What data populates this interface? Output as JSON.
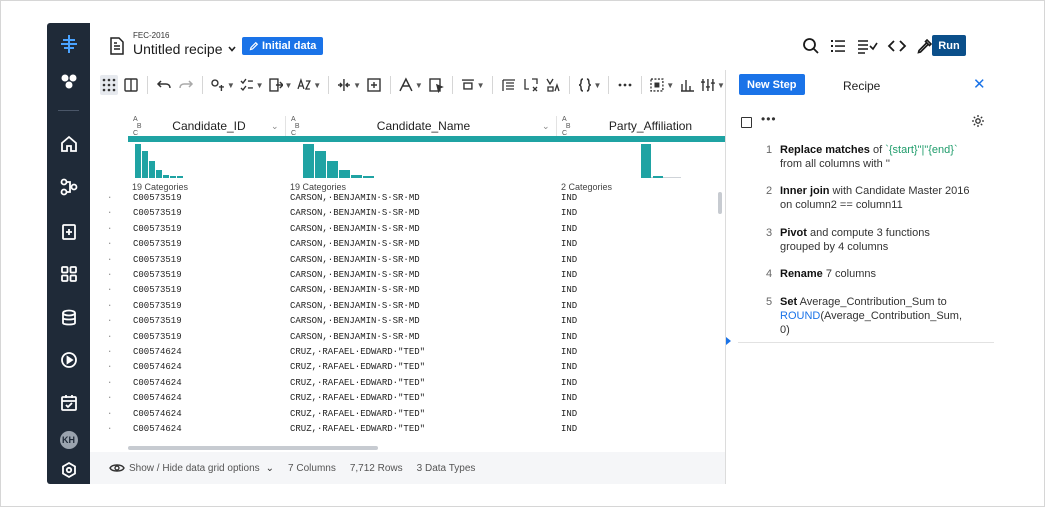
{
  "header": {
    "flow_name": "FEC-2016",
    "recipe_title": "Untitled recipe",
    "badge_label": "Initial data",
    "run_label": "Run",
    "icons": [
      "search-icon",
      "list-icon",
      "list-check-icon",
      "code-icon",
      "pipette-icon"
    ]
  },
  "rail": {
    "icons": [
      "logo-icon",
      "molecule-icon",
      "home-icon",
      "flow-icon",
      "recipe-icon",
      "grid-apps-icon",
      "database-icon",
      "play-circle-icon",
      "calendar-icon"
    ],
    "avatar": "KH"
  },
  "toolbar": {
    "icons": [
      "grid-icon",
      "columns-icon",
      "undo-icon",
      "redo-icon",
      "replace-icon",
      "checklist-icon",
      "export-icon",
      "sort-az-icon",
      "split-icon",
      "merge-icon",
      "font-icon",
      "cursor-icon",
      "layout-icon",
      "row-format-icon",
      "transform-icon",
      "filter-icon",
      "braces-icon",
      "more-icon",
      "select-icon",
      "chart-icon",
      "sliders-icon"
    ]
  },
  "grid": {
    "columns": [
      {
        "name": "Candidate_ID",
        "categories": "19 Categories"
      },
      {
        "name": "Candidate_Name",
        "categories": "19 Categories"
      },
      {
        "name": "Party_Affiliation",
        "categories": "2 Categories"
      }
    ],
    "rows": [
      [
        "C00573519",
        "CARSON,·BENJAMIN·S·SR·MD",
        "IND"
      ],
      [
        "C00573519",
        "CARSON,·BENJAMIN·S·SR·MD",
        "IND"
      ],
      [
        "C00573519",
        "CARSON,·BENJAMIN·S·SR·MD",
        "IND"
      ],
      [
        "C00573519",
        "CARSON,·BENJAMIN·S·SR·MD",
        "IND"
      ],
      [
        "C00573519",
        "CARSON,·BENJAMIN·S·SR·MD",
        "IND"
      ],
      [
        "C00573519",
        "CARSON,·BENJAMIN·S·SR·MD",
        "IND"
      ],
      [
        "C00573519",
        "CARSON,·BENJAMIN·S·SR·MD",
        "IND"
      ],
      [
        "C00573519",
        "CARSON,·BENJAMIN·S·SR·MD",
        "IND"
      ],
      [
        "C00573519",
        "CARSON,·BENJAMIN·S·SR·MD",
        "IND"
      ],
      [
        "C00573519",
        "CARSON,·BENJAMIN·S·SR·MD",
        "IND"
      ],
      [
        "C00574624",
        "CRUZ,·RAFAEL·EDWARD·\"TED\"",
        "IND"
      ],
      [
        "C00574624",
        "CRUZ,·RAFAEL·EDWARD·\"TED\"",
        "IND"
      ],
      [
        "C00574624",
        "CRUZ,·RAFAEL·EDWARD·\"TED\"",
        "IND"
      ],
      [
        "C00574624",
        "CRUZ,·RAFAEL·EDWARD·\"TED\"",
        "IND"
      ],
      [
        "C00574624",
        "CRUZ,·RAFAEL·EDWARD·\"TED\"",
        "IND"
      ],
      [
        "C00574624",
        "CRUZ,·RAFAEL·EDWARD·\"TED\"",
        "IND"
      ]
    ],
    "row_marker": "·"
  },
  "footer": {
    "options_label": "Show / Hide data grid options",
    "columns": "7 Columns",
    "rows": "7,712 Rows",
    "types": "3 Data Types"
  },
  "recipe": {
    "new_step_label": "New Step",
    "title": "Recipe",
    "close_label": "✕",
    "more_label": "•••",
    "steps": [
      {
        "n": "1",
        "verb": "Replace matches",
        "rest1": " of ",
        "pattern": "`{start}\"|\"{end}`",
        "line2": "from all columns with ''"
      },
      {
        "n": "2",
        "verb": "Inner join",
        "rest1": " with Candidate Master 2016",
        "line2": "on column2 == column11"
      },
      {
        "n": "3",
        "verb": "Pivot",
        "rest1": " and compute 3 functions",
        "line2": "grouped by 4 columns"
      },
      {
        "n": "4",
        "verb": "Rename",
        "rest1": " 7 columns"
      },
      {
        "n": "5",
        "verb": "Set",
        "rest1": " Average_Contribution_Sum to",
        "fn": "ROUND",
        "line2": "(Average_Contribution_Sum,",
        "line3": "0)"
      }
    ]
  },
  "colors": {
    "rail": "#1f2a38",
    "accent": "#1a73e8",
    "run": "#0b4f8a",
    "histogram": "#1fa3a3",
    "pattern": "#1f9c6b"
  }
}
